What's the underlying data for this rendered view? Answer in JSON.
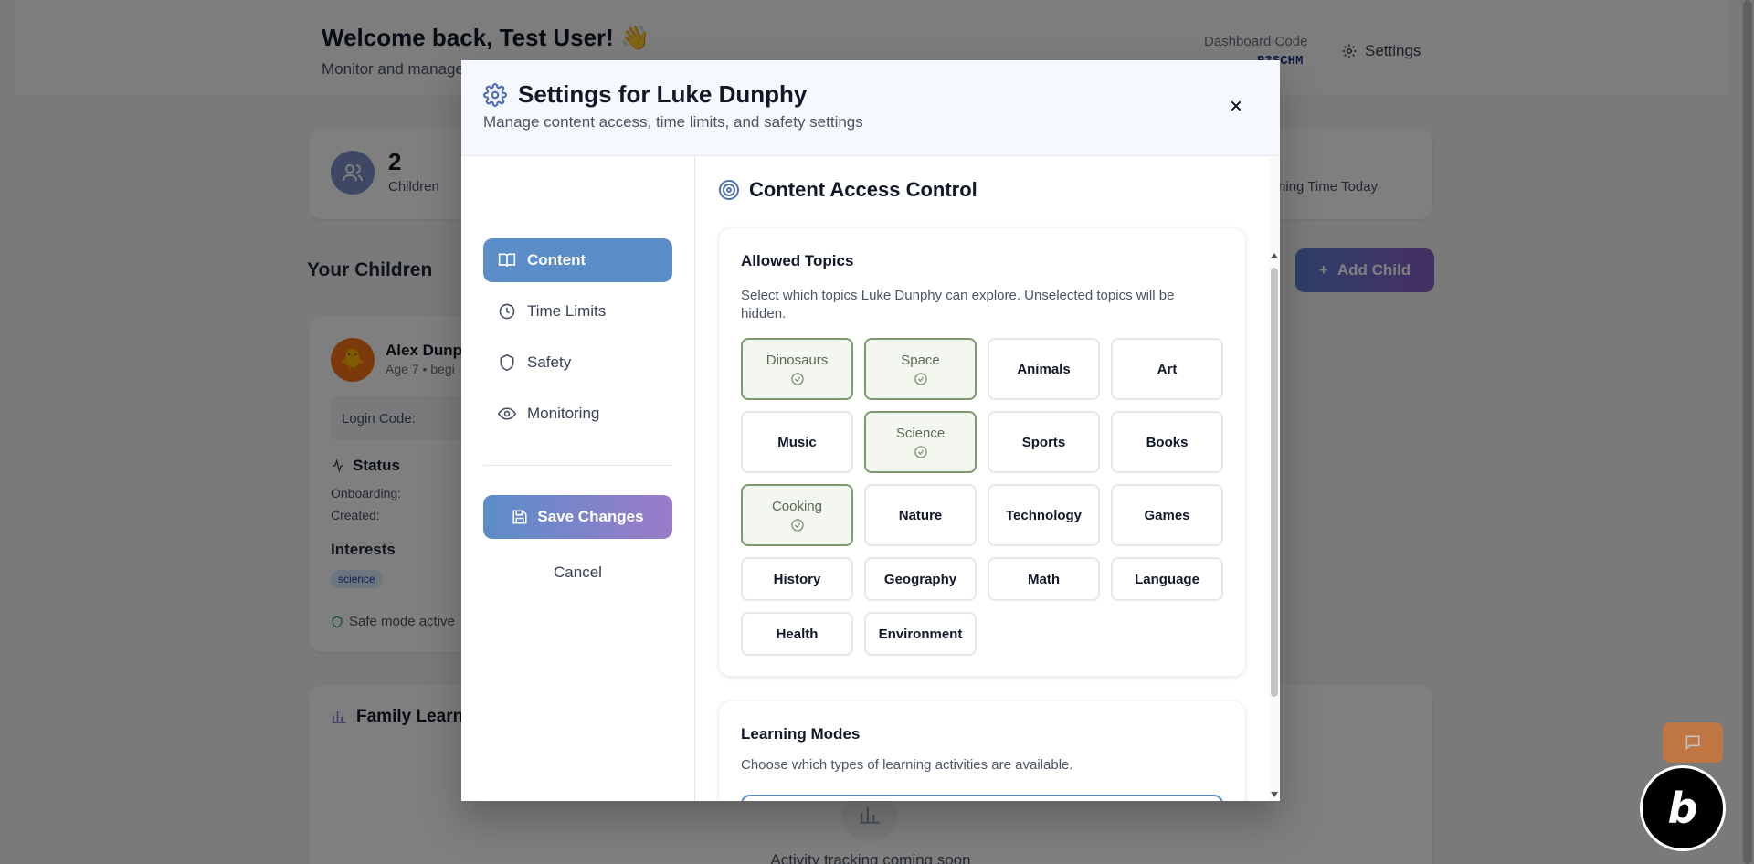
{
  "dashboard": {
    "welcome": "Welcome back, Test User! 👋",
    "subtitle": "Monitor and manage y",
    "dashboard_code_label": "Dashboard Code",
    "dashboard_code_value": "P3SCHM",
    "settings_label": "Settings",
    "stats": {
      "children_count": "2",
      "children_label": "Children",
      "learning_time_label": "ning Time Today"
    },
    "your_children_heading": "Your Children",
    "add_child_label": "Add Child",
    "child": {
      "name": "Alex Dunpl",
      "meta": "Age 7 • begi",
      "login_code_label": "Login Code:",
      "status_heading": "Status",
      "onboarding_label": "Onboarding:",
      "created_label": "Created:",
      "interests_heading": "Interests",
      "interest_chip": "science",
      "safe_mode": "Safe mode active"
    },
    "family": {
      "heading": "Family Learni",
      "activity_text": "Activity tracking coming soon"
    }
  },
  "modal": {
    "title": "Settings for Luke Dunphy",
    "subtitle": "Manage content access, time limits, and safety settings",
    "nav": [
      {
        "label": "Content",
        "icon": "book-icon",
        "active": true
      },
      {
        "label": "Time Limits",
        "icon": "clock-icon",
        "active": false
      },
      {
        "label": "Safety",
        "icon": "shield-icon",
        "active": false
      },
      {
        "label": "Monitoring",
        "icon": "eye-icon",
        "active": false
      }
    ],
    "save_label": "Save Changes",
    "cancel_label": "Cancel",
    "section_title": "Content Access Control",
    "topics_panel": {
      "heading": "Allowed Topics",
      "description": "Select which topics Luke Dunphy can explore. Unselected topics will be hidden.",
      "topics": [
        {
          "label": "Dinosaurs",
          "selected": true
        },
        {
          "label": "Space",
          "selected": true
        },
        {
          "label": "Animals",
          "selected": false
        },
        {
          "label": "Art",
          "selected": false
        },
        {
          "label": "Music",
          "selected": false
        },
        {
          "label": "Science",
          "selected": true
        },
        {
          "label": "Sports",
          "selected": false
        },
        {
          "label": "Books",
          "selected": false
        },
        {
          "label": "Cooking",
          "selected": true
        },
        {
          "label": "Nature",
          "selected": false
        },
        {
          "label": "Technology",
          "selected": false
        },
        {
          "label": "Games",
          "selected": false
        },
        {
          "label": "History",
          "selected": false
        },
        {
          "label": "Geography",
          "selected": false
        },
        {
          "label": "Math",
          "selected": false
        },
        {
          "label": "Language",
          "selected": false
        },
        {
          "label": "Health",
          "selected": false
        },
        {
          "label": "Environment",
          "selected": false
        }
      ]
    },
    "modes_panel": {
      "heading": "Learning Modes",
      "description": "Choose which types of learning activities are available."
    }
  },
  "colors": {
    "accent": "#5b8dc9",
    "selected_border": "#7b9a70",
    "selected_bg": "#f3f7ef"
  }
}
